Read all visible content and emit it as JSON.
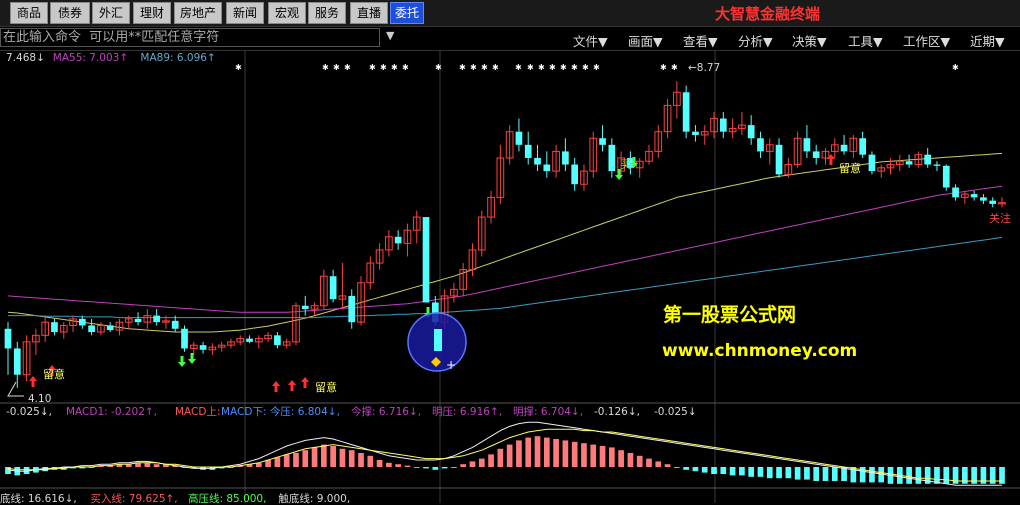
{
  "nav": {
    "buttons": [
      "商品",
      "债券",
      "外汇",
      "理财",
      "房地产",
      "新闻",
      "宏观",
      "服务",
      "直播",
      "委托"
    ],
    "active_index": 9
  },
  "brand": "大智慧金融终端",
  "command": {
    "placeholder": "在此输入命令  可以用**匹配任意字符",
    "dropdown_icon": "triangle-down-icon"
  },
  "menus": [
    "文件▼",
    "画面▼",
    "查看▼",
    "分析▼",
    "决策▼",
    "工具▼",
    "工作区▼",
    "近期▼"
  ],
  "ma_legend": [
    {
      "text": "7.468↓",
      "color": "#d8d8d8"
    },
    {
      "text": "MA55: 7.003↑",
      "color": "#c040c0"
    },
    {
      "text": "MA89: 6.096↑",
      "color": "#66a8c8"
    }
  ],
  "price_labels": {
    "high": "8.77",
    "low": "4.10"
  },
  "annotations": [
    "留意",
    "留意",
    "留意",
    "关注",
    "买"
  ],
  "watermark": {
    "title": "第一股票公式网",
    "url": "www.chnmoney.com"
  },
  "macd_legend": [
    {
      "text": "-0.025↓,",
      "color": "#d8d8d8"
    },
    {
      "text": "MACD1: -0.202↑,",
      "color": "#c040c0"
    },
    {
      "text": "MACD上:",
      "color": "#ff5555"
    },
    {
      "text": "MACD下: 今压: 6.804↓,",
      "color": "#4a90ff"
    },
    {
      "text": "今撑: 6.716↓,",
      "color": "#c040c0"
    },
    {
      "text": "明压: 6.916↑,",
      "color": "#c040c0"
    },
    {
      "text": "明撑: 6.704↓,",
      "color": "#c040c0"
    },
    {
      "text": "-0.126↓,",
      "color": "#d8d8d8"
    },
    {
      "text": "-0.025↓",
      "color": "#d8d8d8"
    }
  ],
  "bottom_legend": [
    {
      "text": "底线: 16.616↓,",
      "color": "#d8d8d8"
    },
    {
      "text": "买入线: 79.625↑,",
      "color": "#ff5555"
    },
    {
      "text": "高压线: 85.000,",
      "color": "#4cff4c"
    },
    {
      "text": "触底线: 9.000,",
      "color": "#d8d8d8"
    }
  ],
  "colors": {
    "up": "#ff4040",
    "down": "#54ffff",
    "ma_yellow": "#cccc66",
    "ma_magenta": "#c040c0",
    "ma_teal": "#3a9cc0"
  },
  "chart_data": {
    "type": "candlestick",
    "candles": [
      [
        5.0,
        5.1,
        4.3,
        4.7
      ],
      [
        4.7,
        4.8,
        4.1,
        4.3
      ],
      [
        4.3,
        4.9,
        4.2,
        4.8
      ],
      [
        4.8,
        5.0,
        4.6,
        4.9
      ],
      [
        4.9,
        5.2,
        4.8,
        5.1
      ],
      [
        5.1,
        5.15,
        4.9,
        4.95
      ],
      [
        4.95,
        5.1,
        4.85,
        5.05
      ],
      [
        5.05,
        5.2,
        4.95,
        5.15
      ],
      [
        5.15,
        5.2,
        5.0,
        5.05
      ],
      [
        5.05,
        5.15,
        4.9,
        4.95
      ],
      [
        4.95,
        5.1,
        4.9,
        5.05
      ],
      [
        5.05,
        5.1,
        4.95,
        4.98
      ],
      [
        4.98,
        5.15,
        4.9,
        5.1
      ],
      [
        5.1,
        5.2,
        5.0,
        5.15
      ],
      [
        5.15,
        5.25,
        5.05,
        5.1
      ],
      [
        5.1,
        5.3,
        5.0,
        5.2
      ],
      [
        5.2,
        5.3,
        5.05,
        5.1
      ],
      [
        5.1,
        5.2,
        5.0,
        5.12
      ],
      [
        5.12,
        5.2,
        4.95,
        5.0
      ],
      [
        5.0,
        5.05,
        4.65,
        4.7
      ],
      [
        4.7,
        4.8,
        4.6,
        4.75
      ],
      [
        4.75,
        4.8,
        4.62,
        4.68
      ],
      [
        4.68,
        4.78,
        4.6,
        4.72
      ],
      [
        4.72,
        4.8,
        4.65,
        4.75
      ],
      [
        4.75,
        4.85,
        4.7,
        4.8
      ],
      [
        4.8,
        4.9,
        4.75,
        4.85
      ],
      [
        4.85,
        4.9,
        4.78,
        4.8
      ],
      [
        4.8,
        4.9,
        4.7,
        4.85
      ],
      [
        4.85,
        4.95,
        4.8,
        4.9
      ],
      [
        4.9,
        4.95,
        4.7,
        4.75
      ],
      [
        4.75,
        4.85,
        4.7,
        4.8
      ],
      [
        4.8,
        5.4,
        4.75,
        5.35
      ],
      [
        5.35,
        5.5,
        5.2,
        5.3
      ],
      [
        5.3,
        5.4,
        5.2,
        5.35
      ],
      [
        5.35,
        5.9,
        5.3,
        5.8
      ],
      [
        5.8,
        5.9,
        5.4,
        5.45
      ],
      [
        5.45,
        6.0,
        5.3,
        5.5
      ],
      [
        5.5,
        5.6,
        5.0,
        5.1
      ],
      [
        5.1,
        5.8,
        5.05,
        5.7
      ],
      [
        5.7,
        6.1,
        5.6,
        6.0
      ],
      [
        6.0,
        6.3,
        5.9,
        6.2
      ],
      [
        6.2,
        6.5,
        6.1,
        6.4
      ],
      [
        6.4,
        6.5,
        6.2,
        6.3
      ],
      [
        6.3,
        6.6,
        6.1,
        6.5
      ],
      [
        6.5,
        6.8,
        6.3,
        6.7
      ],
      [
        6.7,
        6.6,
        5.9,
        5.4
      ],
      [
        5.4,
        5.5,
        5.05,
        5.1
      ],
      [
        5.1,
        5.6,
        5.0,
        5.5
      ],
      [
        5.5,
        5.7,
        5.4,
        5.6
      ],
      [
        5.6,
        6.0,
        5.5,
        5.9
      ],
      [
        5.9,
        6.3,
        5.8,
        6.2
      ],
      [
        6.2,
        6.8,
        6.1,
        6.7
      ],
      [
        6.7,
        7.1,
        6.6,
        7.0
      ],
      [
        7.0,
        7.8,
        6.9,
        7.6
      ],
      [
        7.6,
        8.1,
        7.5,
        8.0
      ],
      [
        8.0,
        8.2,
        7.7,
        7.8
      ],
      [
        7.8,
        8.0,
        7.5,
        7.6
      ],
      [
        7.6,
        7.8,
        7.4,
        7.5
      ],
      [
        7.5,
        7.7,
        7.3,
        7.4
      ],
      [
        7.4,
        7.8,
        7.3,
        7.7
      ],
      [
        7.7,
        7.9,
        7.4,
        7.5
      ],
      [
        7.5,
        7.6,
        7.1,
        7.2
      ],
      [
        7.2,
        7.5,
        7.1,
        7.4
      ],
      [
        7.4,
        8.0,
        7.3,
        7.9
      ],
      [
        7.9,
        8.1,
        7.7,
        7.8
      ],
      [
        7.8,
        7.9,
        7.3,
        7.4
      ],
      [
        7.4,
        7.7,
        7.3,
        7.6
      ],
      [
        7.6,
        7.7,
        7.35,
        7.45
      ],
      [
        7.45,
        7.6,
        7.3,
        7.55
      ],
      [
        7.55,
        7.8,
        7.5,
        7.7
      ],
      [
        7.7,
        8.1,
        7.6,
        8.0
      ],
      [
        8.0,
        8.5,
        7.9,
        8.4
      ],
      [
        8.4,
        8.77,
        8.2,
        8.6
      ],
      [
        8.6,
        8.7,
        7.9,
        8.0
      ],
      [
        8.0,
        8.1,
        7.85,
        7.95
      ],
      [
        7.95,
        8.1,
        7.8,
        8.0
      ],
      [
        8.0,
        8.3,
        7.9,
        8.2
      ],
      [
        8.2,
        8.3,
        7.9,
        8.0
      ],
      [
        8.0,
        8.2,
        7.9,
        8.05
      ],
      [
        8.05,
        8.3,
        7.95,
        8.1
      ],
      [
        8.1,
        8.25,
        7.8,
        7.9
      ],
      [
        7.9,
        8.0,
        7.6,
        7.7
      ],
      [
        7.7,
        7.9,
        7.5,
        7.8
      ],
      [
        7.8,
        7.9,
        7.3,
        7.35
      ],
      [
        7.35,
        7.6,
        7.3,
        7.5
      ],
      [
        7.5,
        8.0,
        7.45,
        7.9
      ],
      [
        7.9,
        8.1,
        7.6,
        7.7
      ],
      [
        7.7,
        7.8,
        7.5,
        7.6
      ],
      [
        7.6,
        7.75,
        7.5,
        7.7
      ],
      [
        7.7,
        7.9,
        7.6,
        7.8
      ],
      [
        7.8,
        7.95,
        7.65,
        7.7
      ],
      [
        7.7,
        7.95,
        7.6,
        7.9
      ],
      [
        7.9,
        8.0,
        7.6,
        7.65
      ],
      [
        7.65,
        7.7,
        7.35,
        7.4
      ],
      [
        7.4,
        7.5,
        7.3,
        7.45
      ],
      [
        7.45,
        7.6,
        7.35,
        7.5
      ],
      [
        7.5,
        7.65,
        7.4,
        7.55
      ],
      [
        7.55,
        7.65,
        7.45,
        7.5
      ],
      [
        7.5,
        7.7,
        7.45,
        7.65
      ],
      [
        7.65,
        7.75,
        7.45,
        7.5
      ],
      [
        7.5,
        7.55,
        7.4,
        7.48
      ],
      [
        7.48,
        7.5,
        7.1,
        7.15
      ],
      [
        7.15,
        7.2,
        6.95,
        7.0
      ],
      [
        7.0,
        7.1,
        6.9,
        7.05
      ],
      [
        7.05,
        7.1,
        6.95,
        7.0
      ],
      [
        7.0,
        7.05,
        6.9,
        6.95
      ],
      [
        6.95,
        7.0,
        6.85,
        6.9
      ],
      [
        6.9,
        7.0,
        6.85,
        6.92
      ]
    ],
    "ma_series": [
      {
        "name": "MA55",
        "values": [
          5.25,
          5.24,
          5.22,
          5.2,
          5.18,
          5.16,
          5.14,
          5.12,
          5.1,
          5.08,
          5.06,
          5.04,
          5.02,
          5.0,
          4.99,
          4.98,
          4.97,
          4.96,
          4.95,
          4.95,
          4.95,
          4.95,
          4.95,
          4.96,
          4.97,
          4.98,
          5.0,
          5.02,
          5.04,
          5.07,
          5.1,
          5.13,
          5.16,
          5.2,
          5.24,
          5.28,
          5.32,
          5.36,
          5.4,
          5.44,
          5.48,
          5.52,
          5.56,
          5.6,
          5.64,
          5.68,
          5.72,
          5.76,
          5.8,
          5.85,
          5.9,
          5.95,
          6.0,
          6.05,
          6.1,
          6.15,
          6.2,
          6.25,
          6.3,
          6.35,
          6.4,
          6.45,
          6.5,
          6.55,
          6.6,
          6.65,
          6.7,
          6.75,
          6.8,
          6.85,
          6.9,
          6.95,
          7.0,
          7.03,
          7.06,
          7.09,
          7.12,
          7.15,
          7.18,
          7.21,
          7.24,
          7.27,
          7.3,
          7.32,
          7.34,
          7.36,
          7.38,
          7.4,
          7.42,
          7.44,
          7.46,
          7.48,
          7.5,
          7.52,
          7.54,
          7.55,
          7.56,
          7.57,
          7.58,
          7.59,
          7.6,
          7.61,
          7.62,
          7.63,
          7.64,
          7.65,
          7.66,
          7.67
        ]
      },
      {
        "name": "MA89",
        "values": [
          5.5,
          5.49,
          5.48,
          5.47,
          5.46,
          5.45,
          5.44,
          5.43,
          5.42,
          5.41,
          5.4,
          5.39,
          5.38,
          5.37,
          5.36,
          5.35,
          5.34,
          5.33,
          5.32,
          5.31,
          5.3,
          5.29,
          5.28,
          5.27,
          5.26,
          5.25,
          5.25,
          5.25,
          5.25,
          5.25,
          5.25,
          5.26,
          5.27,
          5.28,
          5.29,
          5.3,
          5.31,
          5.32,
          5.33,
          5.34,
          5.35,
          5.36,
          5.37,
          5.38,
          5.4,
          5.42,
          5.44,
          5.46,
          5.48,
          5.5,
          5.53,
          5.56,
          5.59,
          5.62,
          5.65,
          5.68,
          5.71,
          5.74,
          5.77,
          5.8,
          5.83,
          5.86,
          5.89,
          5.92,
          5.95,
          5.98,
          6.01,
          6.04,
          6.07,
          6.1,
          6.13,
          6.16,
          6.19,
          6.22,
          6.25,
          6.28,
          6.31,
          6.34,
          6.37,
          6.4,
          6.43,
          6.46,
          6.49,
          6.52,
          6.55,
          6.58,
          6.61,
          6.64,
          6.67,
          6.7,
          6.73,
          6.76,
          6.79,
          6.82,
          6.85,
          6.88,
          6.91,
          6.94,
          6.97,
          7.0,
          7.03,
          7.05,
          7.07,
          7.09,
          7.11,
          7.13,
          7.15,
          7.17
        ]
      },
      {
        "name": "MA120",
        "values": [
          5.2,
          5.2,
          5.2,
          5.2,
          5.19,
          5.19,
          5.19,
          5.19,
          5.18,
          5.18,
          5.18,
          5.18,
          5.17,
          5.17,
          5.17,
          5.17,
          5.17,
          5.17,
          5.17,
          5.17,
          5.17,
          5.17,
          5.17,
          5.17,
          5.17,
          5.17,
          5.17,
          5.17,
          5.17,
          5.17,
          5.17,
          5.17,
          5.17,
          5.17,
          5.18,
          5.18,
          5.19,
          5.19,
          5.2,
          5.2,
          5.21,
          5.21,
          5.22,
          5.22,
          5.23,
          5.23,
          5.24,
          5.25,
          5.26,
          5.27,
          5.28,
          5.29,
          5.3,
          5.31,
          5.33,
          5.35,
          5.37,
          5.39,
          5.41,
          5.43,
          5.45,
          5.47,
          5.49,
          5.51,
          5.53,
          5.55,
          5.57,
          5.59,
          5.61,
          5.63,
          5.65,
          5.67,
          5.69,
          5.71,
          5.73,
          5.75,
          5.77,
          5.79,
          5.81,
          5.83,
          5.85,
          5.87,
          5.89,
          5.91,
          5.93,
          5.95,
          5.97,
          5.99,
          6.01,
          6.03,
          6.05,
          6.07,
          6.09,
          6.11,
          6.13,
          6.15,
          6.17,
          6.19,
          6.21,
          6.23,
          6.25,
          6.27,
          6.29,
          6.31,
          6.33,
          6.35,
          6.37,
          6.39
        ]
      }
    ],
    "macd_hist": [
      -0.05,
      -0.06,
      -0.05,
      -0.04,
      -0.03,
      -0.02,
      -0.02,
      -0.01,
      -0.01,
      0.0,
      0.01,
      0.01,
      0.02,
      0.02,
      0.03,
      0.03,
      0.02,
      0.02,
      0.01,
      0.0,
      -0.01,
      -0.02,
      -0.02,
      -0.01,
      0.0,
      0.01,
      0.02,
      0.03,
      0.05,
      0.07,
      0.09,
      0.1,
      0.12,
      0.14,
      0.16,
      0.15,
      0.13,
      0.12,
      0.1,
      0.08,
      0.05,
      0.03,
      0.02,
      0.01,
      0.0,
      -0.01,
      -0.02,
      -0.01,
      0.0,
      0.02,
      0.04,
      0.06,
      0.09,
      0.13,
      0.16,
      0.19,
      0.21,
      0.22,
      0.21,
      0.2,
      0.19,
      0.18,
      0.17,
      0.16,
      0.15,
      0.14,
      0.12,
      0.1,
      0.08,
      0.06,
      0.04,
      0.02,
      0.0,
      -0.02,
      -0.03,
      -0.04,
      -0.05,
      -0.05,
      -0.06,
      -0.06,
      -0.07,
      -0.07,
      -0.08,
      -0.08,
      -0.08,
      -0.09,
      -0.09,
      -0.1,
      -0.1,
      -0.1,
      -0.1,
      -0.11,
      -0.11,
      -0.11,
      -0.11,
      -0.12,
      -0.12,
      -0.12,
      -0.12,
      -0.12,
      -0.12,
      -0.12,
      -0.12,
      -0.12,
      -0.12,
      -0.12,
      -0.12,
      -0.12
    ],
    "macd_line_white": [
      -0.02,
      -0.03,
      -0.03,
      -0.02,
      -0.01,
      -0.01,
      0.0,
      0.0,
      0.01,
      0.01,
      0.02,
      0.02,
      0.03,
      0.03,
      0.04,
      0.04,
      0.03,
      0.02,
      0.01,
      0.0,
      -0.01,
      -0.01,
      -0.01,
      0.0,
      0.01,
      0.02,
      0.04,
      0.06,
      0.09,
      0.12,
      0.15,
      0.17,
      0.19,
      0.2,
      0.21,
      0.2,
      0.18,
      0.16,
      0.14,
      0.12,
      0.1,
      0.08,
      0.07,
      0.06,
      0.05,
      0.05,
      0.05,
      0.06,
      0.08,
      0.11,
      0.14,
      0.18,
      0.22,
      0.26,
      0.29,
      0.31,
      0.32,
      0.32,
      0.31,
      0.3,
      0.29,
      0.28,
      0.27,
      0.26,
      0.25,
      0.24,
      0.23,
      0.22,
      0.21,
      0.2,
      0.19,
      0.18,
      0.17,
      0.16,
      0.15,
      0.14,
      0.13,
      0.12,
      0.11,
      0.1,
      0.09,
      0.08,
      0.07,
      0.06,
      0.05,
      0.04,
      0.03,
      0.02,
      0.01,
      0.0,
      -0.01,
      -0.02,
      -0.03,
      -0.04,
      -0.05,
      -0.06,
      -0.07,
      -0.08,
      -0.09,
      -0.1,
      -0.11,
      -0.12,
      -0.13,
      -0.13,
      -0.13,
      -0.13,
      -0.13,
      -0.13
    ],
    "macd_line_yellow": [
      -0.01,
      -0.02,
      -0.02,
      -0.02,
      -0.02,
      -0.01,
      -0.01,
      0.0,
      0.0,
      0.0,
      0.01,
      0.01,
      0.02,
      0.02,
      0.03,
      0.03,
      0.03,
      0.02,
      0.02,
      0.01,
      0.0,
      0.0,
      0.0,
      0.0,
      0.0,
      0.01,
      0.02,
      0.03,
      0.05,
      0.07,
      0.09,
      0.11,
      0.13,
      0.14,
      0.15,
      0.16,
      0.15,
      0.14,
      0.13,
      0.12,
      0.11,
      0.1,
      0.09,
      0.08,
      0.07,
      0.06,
      0.06,
      0.06,
      0.07,
      0.08,
      0.1,
      0.12,
      0.15,
      0.18,
      0.21,
      0.23,
      0.25,
      0.26,
      0.27,
      0.27,
      0.27,
      0.27,
      0.26,
      0.26,
      0.25,
      0.25,
      0.24,
      0.23,
      0.22,
      0.21,
      0.2,
      0.19,
      0.18,
      0.17,
      0.16,
      0.15,
      0.14,
      0.13,
      0.12,
      0.11,
      0.1,
      0.09,
      0.08,
      0.07,
      0.06,
      0.05,
      0.04,
      0.03,
      0.02,
      0.01,
      0.0,
      -0.01,
      -0.02,
      -0.03,
      -0.04,
      -0.05,
      -0.06,
      -0.07,
      -0.08,
      -0.08,
      -0.09,
      -0.09,
      -0.1,
      -0.1,
      -0.1,
      -0.1,
      -0.1,
      -0.1
    ]
  }
}
